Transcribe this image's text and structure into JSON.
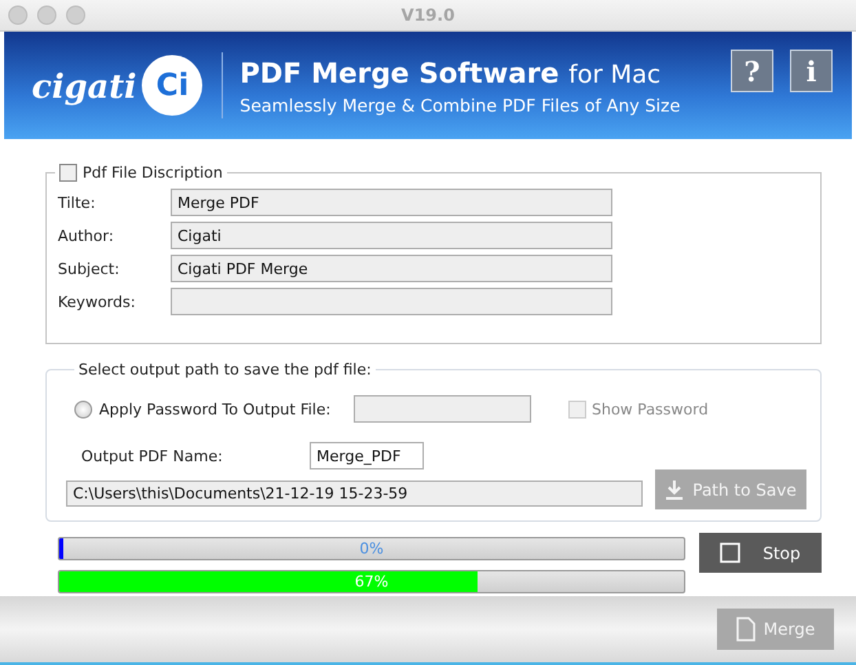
{
  "window": {
    "title": "V19.0"
  },
  "header": {
    "logo_text": "cigati",
    "logo_mark": "Ci",
    "title": "PDF Merge Software",
    "title_suffix": "for Mac",
    "tagline": "Seamlessly Merge & Combine PDF Files of Any Size",
    "buttons": [
      "?",
      "i"
    ]
  },
  "description": {
    "label": "Pdf File Discription",
    "checked": false,
    "fields": [
      {
        "label": "Tilte:",
        "value": "Merge PDF"
      },
      {
        "label": "Author:",
        "value": "Cigati"
      },
      {
        "label": "Subject:",
        "value": "Cigati PDF  Merge"
      },
      {
        "label": "Keywords:"
      }
    ]
  },
  "output": {
    "legend": "Select output path to save the pdf file:",
    "password": {
      "label": "Apply Password To Output File:",
      "selected": false,
      "disabled": true
    },
    "show_password": {
      "label": "Show Password",
      "checked": false,
      "disabled": true
    },
    "name": {
      "label": "Output PDF Name:",
      "value": "Merge_PDF"
    },
    "path": {
      "value": "C:\\Users\\this\\Documents\\21-12-19 15-23-59"
    },
    "path_button": {
      "label": "Path to Save",
      "disabled": true
    }
  },
  "progress": [
    {
      "level": 0.0,
      "reading": "0%",
      "color": "#0000ff"
    },
    {
      "level": 0.67,
      "reading": "67%",
      "color": "#00ff00"
    }
  ],
  "stop_button": {
    "label": "Stop"
  },
  "merge_button": {
    "label": "Merge",
    "disabled": true
  }
}
